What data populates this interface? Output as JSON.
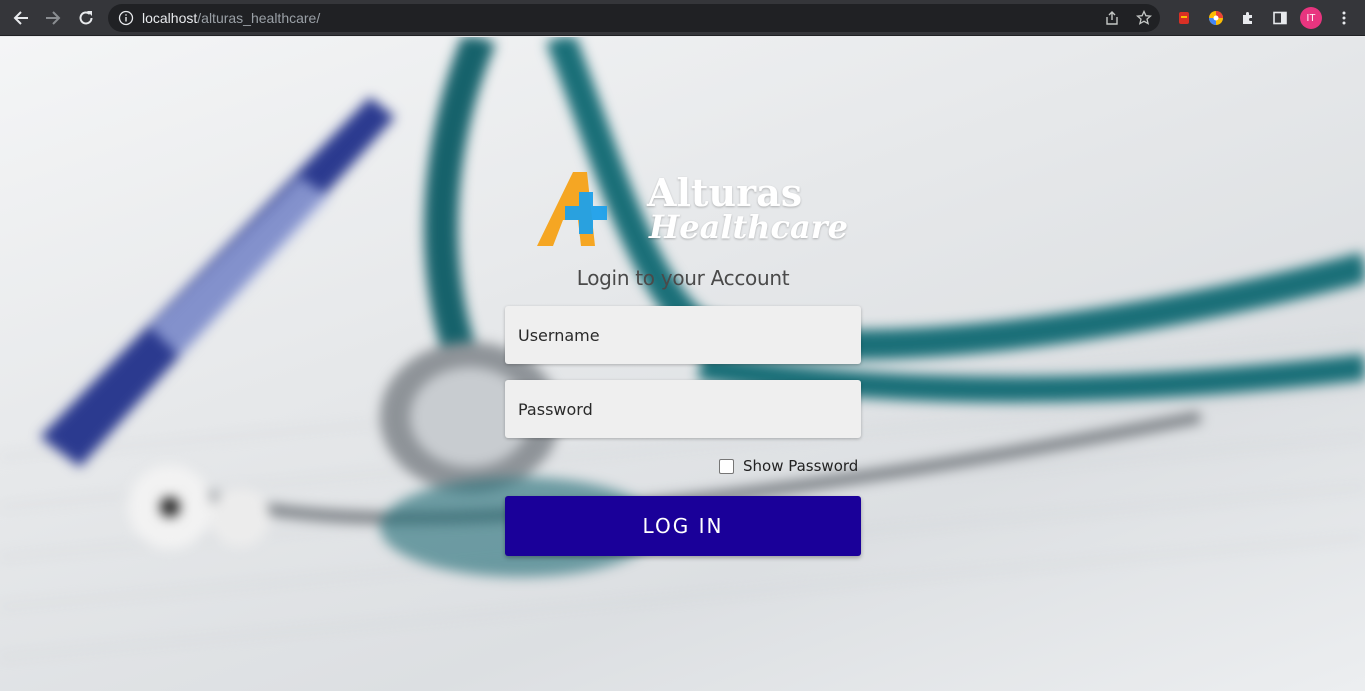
{
  "browser": {
    "url_host": "localhost",
    "url_path": "/alturas_healthcare/",
    "profile_initials": "IT",
    "icons": [
      "back-icon",
      "forward-icon",
      "reload-icon",
      "site-info-icon",
      "share-icon",
      "bookmark-star-icon",
      "extension-red-icon",
      "extension-color-icon",
      "extensions-puzzle-icon",
      "side-panel-icon",
      "menu-kebab-icon"
    ]
  },
  "logo": {
    "brand_line1": "Alturas",
    "brand_line2": "Healthcare",
    "colors": {
      "orange": "#f5a623",
      "blue": "#1ea0ea"
    }
  },
  "login": {
    "title": "Login to your Account",
    "username_placeholder": "Username",
    "password_placeholder": "Password",
    "show_password_label": "Show Password",
    "button_label": "LOG IN"
  },
  "colors": {
    "button_bg": "#1a0099",
    "field_bg": "#efefef"
  }
}
